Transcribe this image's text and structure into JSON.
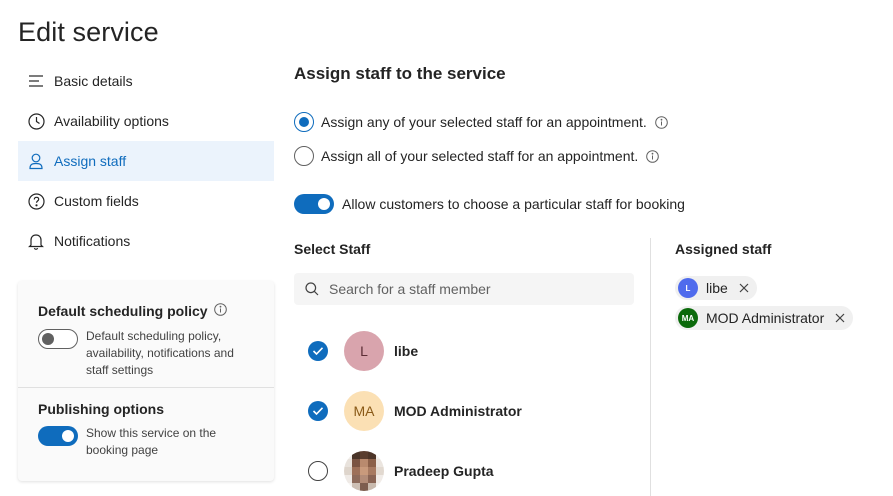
{
  "page": {
    "title": "Edit service"
  },
  "nav": {
    "items": [
      {
        "label": "Basic details",
        "icon": "lines-icon"
      },
      {
        "label": "Availability options",
        "icon": "clock-icon"
      },
      {
        "label": "Assign staff",
        "icon": "person-icon",
        "active": true
      },
      {
        "label": "Custom fields",
        "icon": "question-circle-icon"
      },
      {
        "label": "Notifications",
        "icon": "bell-icon"
      }
    ]
  },
  "policy": {
    "default_title": "Default scheduling policy",
    "default_toggle_on": false,
    "default_desc": "Default scheduling policy, availability, notifications and staff settings",
    "publishing_title": "Publishing options",
    "publishing_toggle_on": true,
    "publishing_desc": "Show this service on the booking page"
  },
  "main": {
    "section_title": "Assign staff to the service",
    "radio_any": "Assign any of your selected staff for an appointment.",
    "radio_any_checked": true,
    "radio_all": "Assign all of your selected staff for an appointment.",
    "radio_all_checked": false,
    "allow_toggle_label": "Allow customers to choose a particular staff for booking",
    "allow_toggle_on": true,
    "select_staff_label": "Select Staff",
    "search_placeholder": "Search for a staff member",
    "staff": [
      {
        "name": "libe",
        "initials": "L",
        "selected": true
      },
      {
        "name": "MOD Administrator",
        "initials": "MA",
        "selected": true
      },
      {
        "name": "Pradeep Gupta",
        "initials": "",
        "selected": false
      }
    ],
    "assigned_label": "Assigned staff",
    "assigned": [
      {
        "name": "libe",
        "initials": "L"
      },
      {
        "name": "MOD Administrator",
        "initials": "MA"
      }
    ]
  },
  "colors": {
    "accent": "#0f6cbd",
    "active_nav_bg": "#ebf3fc",
    "avatar_libe_bg": "#d9a4ad",
    "avatar_mod_bg": "#fbe0b4",
    "chip_libe": "#4f6bed",
    "chip_mod": "#0b6a0b"
  }
}
